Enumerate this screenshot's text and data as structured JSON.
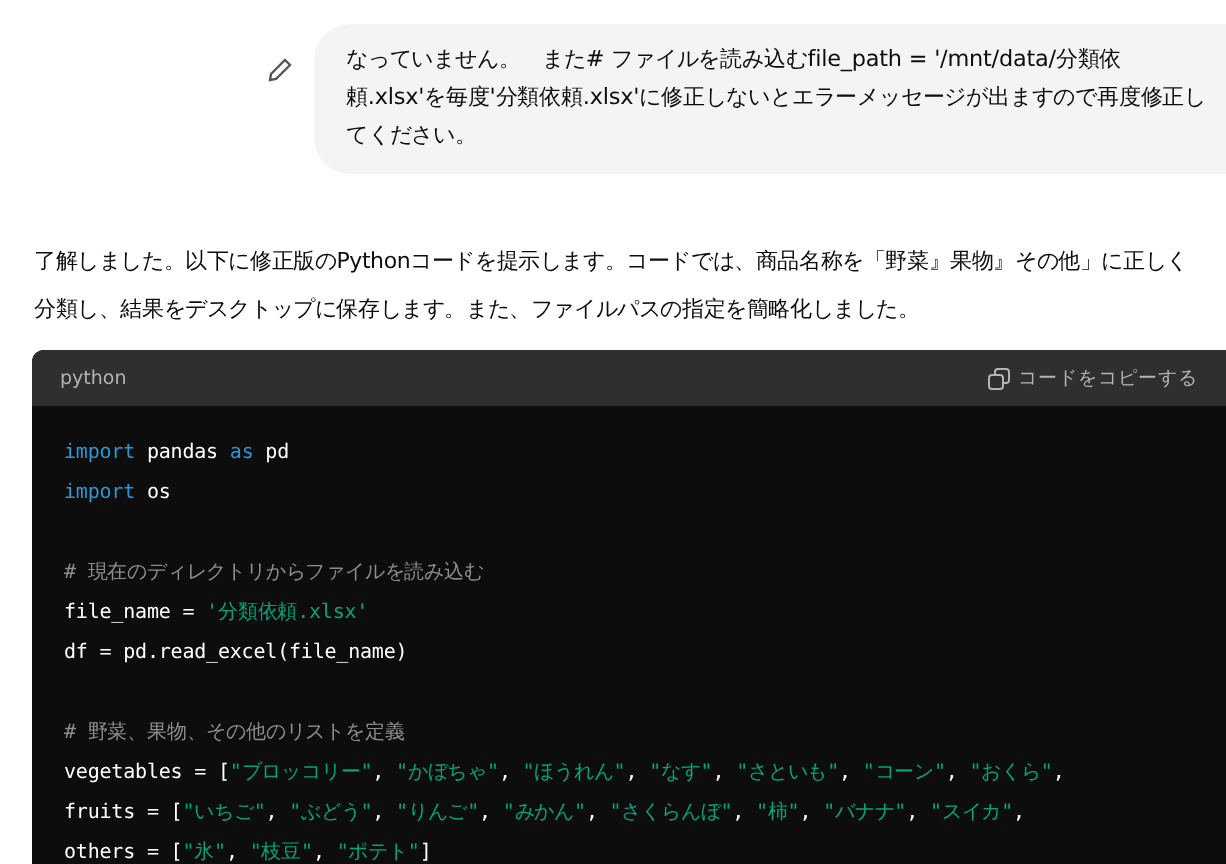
{
  "user_message": {
    "text": "なっていません。　また# ファイルを読み込むfile_path = '/mnt/data/分類依頼.xlsx'を毎度'分類依頼.xlsx'に修正しないとエラーメッセージが出ますので再度修正してください。"
  },
  "assistant_message": {
    "text": "了解しました。以下に修正版のPythonコードを提示します。コードでは、商品名称を「野菜』果物』その他」に正しく分類し、結果をデスクトップに保存します。また、ファイルパスの指定を簡略化しました。"
  },
  "code_block": {
    "language": "python",
    "copy_label": "コードをコピーする",
    "sections": [
      {
        "lines": [
          [
            {
              "kind": "keyword",
              "text": "import"
            },
            {
              "kind": "plain",
              "text": " pandas "
            },
            {
              "kind": "keyword",
              "text": "as"
            },
            {
              "kind": "plain",
              "text": " pd"
            }
          ],
          [
            {
              "kind": "keyword",
              "text": "import"
            },
            {
              "kind": "plain",
              "text": " os"
            }
          ]
        ]
      },
      {
        "lines": [
          [
            {
              "kind": "comment",
              "text": "# 現在のディレクトリからファイルを読み込む"
            }
          ],
          [
            {
              "kind": "plain",
              "text": "file_name = "
            },
            {
              "kind": "string",
              "text": "'分類依頼.xlsx'"
            }
          ],
          [
            {
              "kind": "plain",
              "text": "df = pd.read_excel(file_name)"
            }
          ]
        ]
      },
      {
        "lines": [
          [
            {
              "kind": "comment",
              "text": "# 野菜、果物、その他のリストを定義"
            }
          ],
          [
            {
              "kind": "plain",
              "text": "vegetables = ["
            },
            {
              "kind": "string",
              "text": "\"ブロッコリー\""
            },
            {
              "kind": "plain",
              "text": ", "
            },
            {
              "kind": "string",
              "text": "\"かぼちゃ\""
            },
            {
              "kind": "plain",
              "text": ", "
            },
            {
              "kind": "string",
              "text": "\"ほうれん\""
            },
            {
              "kind": "plain",
              "text": ", "
            },
            {
              "kind": "string",
              "text": "\"なす\""
            },
            {
              "kind": "plain",
              "text": ", "
            },
            {
              "kind": "string",
              "text": "\"さといも\""
            },
            {
              "kind": "plain",
              "text": ", "
            },
            {
              "kind": "string",
              "text": "\"コーン\""
            },
            {
              "kind": "plain",
              "text": ", "
            },
            {
              "kind": "string",
              "text": "\"おくら\""
            },
            {
              "kind": "plain",
              "text": ","
            }
          ],
          [
            {
              "kind": "plain",
              "text": "fruits = ["
            },
            {
              "kind": "string",
              "text": "\"いちご\""
            },
            {
              "kind": "plain",
              "text": ", "
            },
            {
              "kind": "string",
              "text": "\"ぶどう\""
            },
            {
              "kind": "plain",
              "text": ", "
            },
            {
              "kind": "string",
              "text": "\"りんご\""
            },
            {
              "kind": "plain",
              "text": ", "
            },
            {
              "kind": "string",
              "text": "\"みかん\""
            },
            {
              "kind": "plain",
              "text": ", "
            },
            {
              "kind": "string",
              "text": "\"さくらんぼ\""
            },
            {
              "kind": "plain",
              "text": ", "
            },
            {
              "kind": "string",
              "text": "\"柿\""
            },
            {
              "kind": "plain",
              "text": ", "
            },
            {
              "kind": "string",
              "text": "\"バナナ\""
            },
            {
              "kind": "plain",
              "text": ", "
            },
            {
              "kind": "string",
              "text": "\"スイカ\""
            },
            {
              "kind": "plain",
              "text": ","
            }
          ],
          [
            {
              "kind": "plain",
              "text": "others = ["
            },
            {
              "kind": "string",
              "text": "\"氷\""
            },
            {
              "kind": "plain",
              "text": ", "
            },
            {
              "kind": "string",
              "text": "\"枝豆\""
            },
            {
              "kind": "plain",
              "text": ", "
            },
            {
              "kind": "string",
              "text": "\"ポテト\""
            },
            {
              "kind": "plain",
              "text": "]"
            }
          ]
        ]
      }
    ]
  }
}
